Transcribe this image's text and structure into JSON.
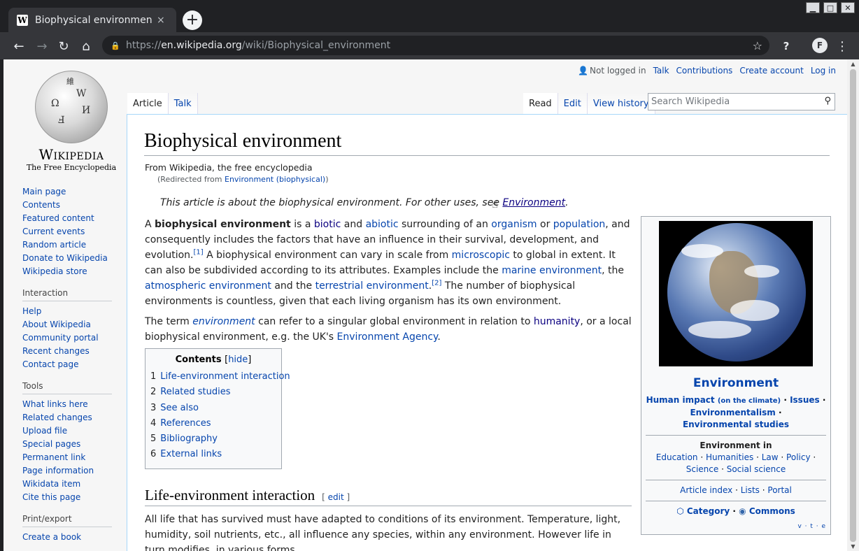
{
  "browser": {
    "tab_title": "Biophysical environment",
    "tab_close": "×",
    "new_tab": "+",
    "url_scheme": "https://",
    "url_host": "en.wikipedia.org",
    "url_path": "/wiki/Biophysical_environment",
    "favicon": "W",
    "avatar": "F"
  },
  "logo": {
    "wordmark": "Wikipedia",
    "tagline": "The Free Encyclopedia",
    "glyphs": [
      "Ω",
      "W",
      "И",
      "Ⅎ",
      "維"
    ]
  },
  "personal": {
    "not_logged_in": "Not logged in",
    "talk": "Talk",
    "contributions": "Contributions",
    "create_account": "Create account",
    "log_in": "Log in"
  },
  "tabs": {
    "article": "Article",
    "talk": "Talk",
    "read": "Read",
    "edit": "Edit",
    "view_history": "View history"
  },
  "search": {
    "placeholder": "Search Wikipedia"
  },
  "sidebar": {
    "navigation": [
      "Main page",
      "Contents",
      "Featured content",
      "Current events",
      "Random article",
      "Donate to Wikipedia",
      "Wikipedia store"
    ],
    "interaction_heading": "Interaction",
    "interaction": [
      "Help",
      "About Wikipedia",
      "Community portal",
      "Recent changes",
      "Contact page"
    ],
    "tools_heading": "Tools",
    "tools": [
      "What links here",
      "Related changes",
      "Upload file",
      "Special pages",
      "Permanent link",
      "Page information",
      "Wikidata item",
      "Cite this page"
    ],
    "print_heading": "Print/export",
    "print": [
      "Create a book"
    ]
  },
  "article": {
    "title": "Biophysical environment",
    "site_sub": "From Wikipedia, the free encyclopedia",
    "redirect_prefix": "(Redirected from ",
    "redirect_link": "Environment (biophysical)",
    "redirect_suffix": ")",
    "hatnote_text": "This article is about the biophysical environment. For other uses, see ",
    "hatnote_link": "Environment",
    "hatnote_end": "."
  },
  "toc": {
    "title": "Contents",
    "hide": "hide",
    "items": [
      {
        "num": "1",
        "label": "Life-environment interaction"
      },
      {
        "num": "2",
        "label": "Related studies"
      },
      {
        "num": "3",
        "label": "See also"
      },
      {
        "num": "4",
        "label": "References"
      },
      {
        "num": "5",
        "label": "Bibliography"
      },
      {
        "num": "6",
        "label": "External links"
      }
    ]
  },
  "section": {
    "heading": "Life-environment interaction",
    "edit": "edit",
    "text": "All life that has survived must have adapted to conditions of its environment. Temperature, light, humidity, soil nutrients, etc., all influence any species, within any environment. However life in turn modifies, in various forms,"
  },
  "infobox": {
    "title": "Environment",
    "human_impact": "Human impact",
    "on_climate": "(on the climate)",
    "issues": "Issues",
    "environmentalism": "Environmentalism",
    "env_studies": "Environmental studies",
    "env_in": "Environment in",
    "env_in_links": [
      "Education",
      "Humanities",
      "Law",
      "Policy",
      "Science",
      "Social science"
    ],
    "index_links": [
      "Article index",
      "Lists",
      "Portal"
    ],
    "category": "Category",
    "commons": "Commons",
    "vte": "v · t · e"
  }
}
